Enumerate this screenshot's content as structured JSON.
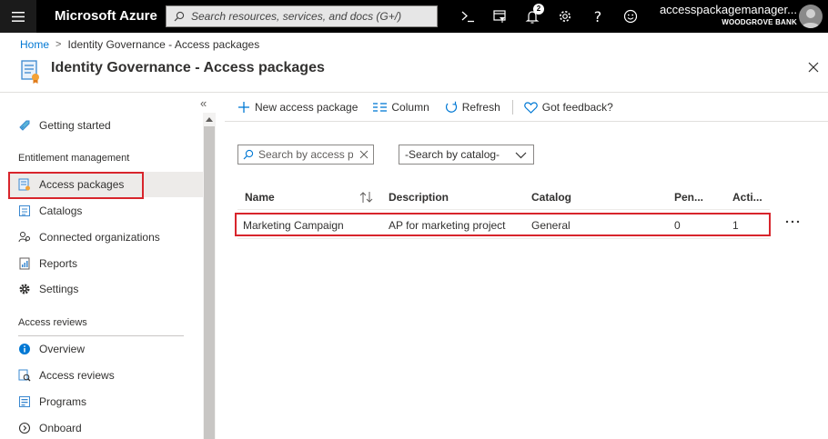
{
  "topbar": {
    "brand": "Microsoft Azure",
    "search_placeholder": "Search resources, services, and docs (G+/)",
    "notification_count": "2",
    "account_name": "accesspackagemanager...",
    "account_org": "WOODGROVE BANK",
    "icons": [
      "menu-icon",
      "search-icon",
      "cloud-shell-icon",
      "directory-filter-icon",
      "notifications-icon",
      "settings-icon",
      "help-icon",
      "feedback-smiley-icon"
    ]
  },
  "breadcrumb": {
    "home": "Home",
    "current": "Identity Governance - Access packages"
  },
  "page": {
    "title": "Identity Governance - Access packages"
  },
  "sidebar": {
    "getting_started": "Getting started",
    "section_entitlement": "Entitlement management",
    "access_packages": "Access packages",
    "catalogs": "Catalogs",
    "connected_orgs": "Connected organizations",
    "reports": "Reports",
    "settings": "Settings",
    "section_reviews": "Access reviews",
    "overview": "Overview",
    "access_reviews": "Access reviews",
    "programs": "Programs",
    "onboard": "Onboard",
    "collapse_glyph": "«"
  },
  "toolbar": {
    "new_package": "New access package",
    "column": "Column",
    "refresh": "Refresh",
    "feedback": "Got feedback?"
  },
  "filters": {
    "search_placeholder": "Search by access pa",
    "catalog_placeholder": "-Search by catalog-"
  },
  "table": {
    "headers": {
      "name": "Name",
      "description": "Description",
      "catalog": "Catalog",
      "pending": "Pen...",
      "active": "Acti..."
    },
    "rows": [
      {
        "name": "Marketing Campaign",
        "description": "AP for marketing project",
        "catalog": "General",
        "pending": "0",
        "active": "1"
      }
    ]
  },
  "colors": {
    "topbar_bg": "#000000",
    "accent": "#0078d4",
    "highlight_border": "#d8252c",
    "active_nav_bg": "#edebe9"
  }
}
